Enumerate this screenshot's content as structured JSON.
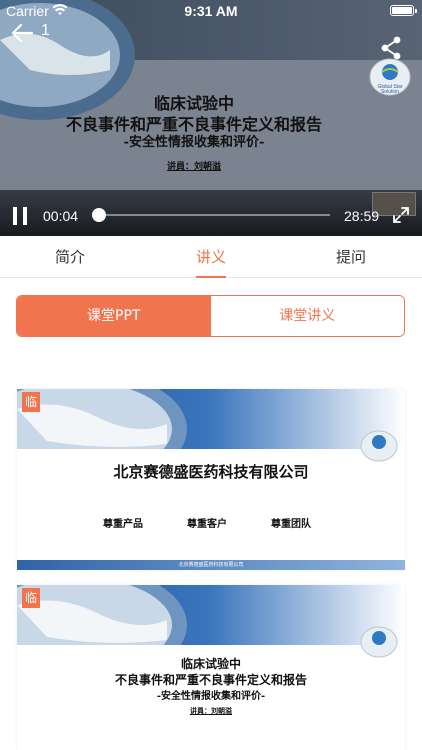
{
  "status_bar": {
    "carrier": "Carrier",
    "time": "9:31 AM"
  },
  "player": {
    "index": "1",
    "slide_title_line1": "临床试验中",
    "slide_title_line2": "不良事件和严重不良事件定义和报告",
    "slide_title_line3": "-安全性情报收集和评价-",
    "slide_speaker": "讲員：刘朝溢",
    "logo_text": "Global Star Solution",
    "time_current": "00:04",
    "time_total": "28:59",
    "progress": 0.002,
    "icons": [
      "back-arrow-icon",
      "share-icon",
      "pause-icon",
      "fullscreen-icon",
      "wifi-icon",
      "battery-icon"
    ]
  },
  "tabs": {
    "intro": "简介",
    "handout": "讲义",
    "ask": "提问",
    "active": "handout",
    "accent_color": "#f0744e"
  },
  "segment": {
    "ppt": "课堂PPT",
    "handout": "课堂讲义",
    "active": "ppt"
  },
  "slides": [
    {
      "badge": "临",
      "company": "北京赛德盛医药科技有限公司",
      "values": [
        "尊重产品",
        "尊重客户",
        "尊重团队"
      ],
      "footer": "北京赛德盛医药科技有限公司"
    },
    {
      "badge": "临",
      "line1": "临床试验中",
      "line2": "不良事件和严重不良事件定义和报告",
      "line3": "-安全性情报收集和评价-",
      "speaker": "讲員：刘朝溢"
    }
  ]
}
